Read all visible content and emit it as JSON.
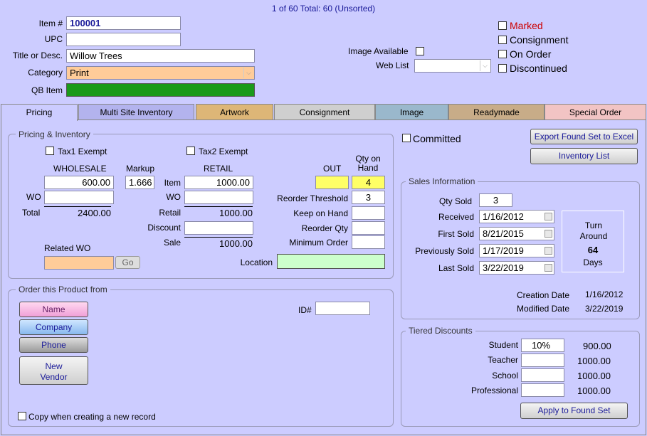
{
  "header": {
    "record_status": "1 of 60  Total: 60  (Unsorted)"
  },
  "top": {
    "item_label": "Item #",
    "item_value": "100001",
    "upc_label": "UPC",
    "upc_value": "",
    "title_label": "Title or Desc.",
    "title_value": "Willow Trees",
    "category_label": "Category",
    "category_value": "Print",
    "qb_label": "QB Item",
    "image_available_label": "Image Available",
    "web_list_label": "Web List",
    "marked_label": "Marked",
    "consignment_label": "Consignment",
    "on_order_label": "On Order",
    "discontinued_label": "Discontinued",
    "colors": {
      "qb_green": "#1a9a1a",
      "category_bg": "#ffcc99",
      "marked_red": "#cc0000"
    }
  },
  "tabs": [
    {
      "label": "Pricing",
      "color": "#ccccff"
    },
    {
      "label": "Multi Site Inventory",
      "color": "#b3b3ee"
    },
    {
      "label": "Artwork",
      "color": "#ddb677"
    },
    {
      "label": "Consignment",
      "color": "#cfcfcf"
    },
    {
      "label": "Image",
      "color": "#9ab8cc"
    },
    {
      "label": "Readymade",
      "color": "#c8ac88"
    },
    {
      "label": "Special Order",
      "color": "#f2c4c4"
    }
  ],
  "pricing": {
    "group_title": "Pricing & Inventory",
    "tax1": "Tax1 Exempt",
    "tax2": "Tax2 Exempt",
    "wholesale_hdr": "WHOLESALE",
    "markup_hdr": "Markup",
    "retail_hdr": "RETAIL",
    "out_hdr": "OUT",
    "qty_hdr": "Qty on Hand",
    "wholesale_value": "600.00",
    "markup_value": "1.666",
    "item_label": "Item",
    "retail_value": "1000.00",
    "wo_label": "WO",
    "wo_label2": "WO",
    "total_label": "Total",
    "total_value": "2400.00",
    "retail_label": "Retail",
    "retail_total": "1000.00",
    "discount_label": "Discount",
    "sale_label": "Sale",
    "sale_value": "1000.00",
    "qty_value": "4",
    "reorder_threshold_label": "Reorder Threshold",
    "reorder_threshold_value": "3",
    "keep_on_hand_label": "Keep on Hand",
    "reorder_qty_label": "Reorder Qty",
    "minimum_order_label": "Minimum Order",
    "related_wo_label": "Related WO",
    "go_label": "Go",
    "location_label": "Location"
  },
  "order": {
    "group_title": "Order this Product from",
    "name_btn": "Name",
    "company_btn": "Company",
    "phone_btn": "Phone",
    "new_vendor_btn": "New Vendor",
    "id_label": "ID#",
    "copy_label": "Copy when creating a new record"
  },
  "right": {
    "committed_label": "Committed",
    "export_btn": "Export Found Set to Excel",
    "inventory_btn": "Inventory List"
  },
  "sales": {
    "group_title": "Sales Information",
    "qty_sold_label": "Qty Sold",
    "qty_sold_value": "3",
    "received_label": "Received",
    "received_value": "1/16/2012",
    "first_sold_label": "First Sold",
    "first_sold_value": "8/21/2015",
    "prev_sold_label": "Previously Sold",
    "prev_sold_value": "1/17/2019",
    "last_sold_label": "Last Sold",
    "last_sold_value": "3/22/2019",
    "turn_label": "Turn Around",
    "turn_value": "64",
    "days_label": "Days",
    "creation_label": "Creation Date",
    "creation_value": "1/16/2012",
    "modified_label": "Modified Date",
    "modified_value": "3/22/2019"
  },
  "tiered": {
    "group_title": "Tiered Discounts",
    "rows": [
      {
        "label": "Student",
        "pct": "10%",
        "price": "900.00"
      },
      {
        "label": "Teacher",
        "pct": "",
        "price": "1000.00"
      },
      {
        "label": "School",
        "pct": "",
        "price": "1000.00"
      },
      {
        "label": "Professional",
        "pct": "",
        "price": "1000.00"
      }
    ],
    "apply_btn": "Apply to Found Set"
  }
}
